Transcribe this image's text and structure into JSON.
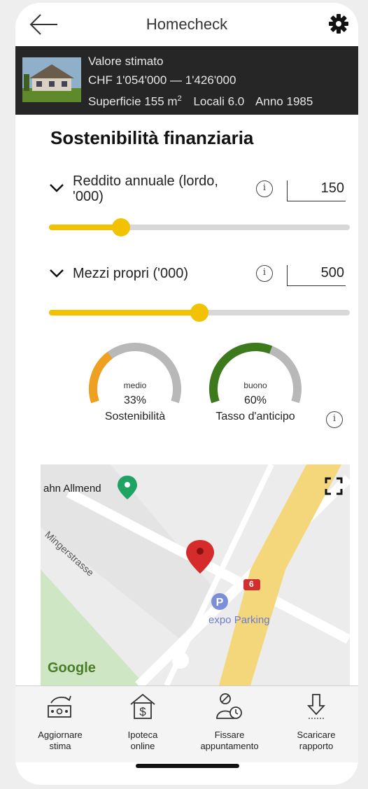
{
  "header": {
    "title": "Homecheck"
  },
  "property": {
    "estimate_label": "Valore stimato",
    "estimate_range": "CHF 1'054'000 — 1'426'000",
    "surface_label": "Superficie",
    "surface_value": "155 m",
    "surface_unit_exp": "2",
    "rooms_label": "Locali",
    "rooms_value": "6.0",
    "year_label": "Anno",
    "year_value": "1985"
  },
  "finance": {
    "title": "Sostenibilità finanziaria",
    "income": {
      "label_line1": "Reddito annuale (lordo,",
      "label_line2": "'000)",
      "value": "150",
      "slider_fraction": 0.24
    },
    "equity": {
      "label": "Mezzi propri ('000)",
      "value": "500",
      "slider_fraction": 0.5
    }
  },
  "gauges": [
    {
      "word": "medio",
      "percent": "33%",
      "name": "Sostenibilità",
      "fraction": 0.33,
      "color": "#f0a020"
    },
    {
      "word": "buono",
      "percent": "60%",
      "name": "Tasso d'anticipo",
      "fraction": 0.6,
      "color": "#3d7a1c"
    }
  ],
  "map": {
    "place_label": "ahn Allmend",
    "street_label": "Mingerstrasse",
    "parking_label": "expo Parking",
    "route_badge": "6",
    "logo": "Google"
  },
  "bottom_nav": [
    {
      "label": "Aggiornare\nstima",
      "icon": "refresh-estimate-icon"
    },
    {
      "label": "Ipoteca\nonline",
      "icon": "mortgage-house-icon"
    },
    {
      "label": "Fissare\nappuntamento",
      "icon": "appointment-icon"
    },
    {
      "label": "Scaricare\nrapporto",
      "icon": "download-icon"
    }
  ],
  "colors": {
    "accent": "#f2c100",
    "band": "#262626",
    "good": "#3d7a1c",
    "medium": "#f0a020",
    "gauge_track": "#b8b8b8"
  }
}
